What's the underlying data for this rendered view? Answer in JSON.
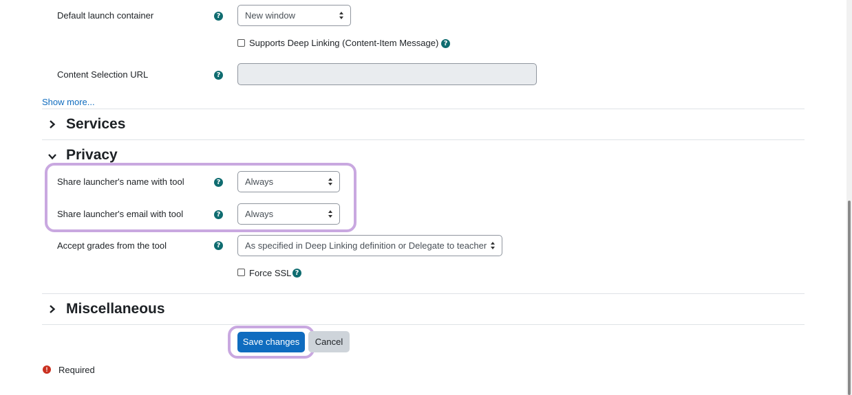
{
  "fields": {
    "launch_container": {
      "label": "Default launch container",
      "value": "New window"
    },
    "deep_linking": {
      "label": "Supports Deep Linking (Content-Item Message)"
    },
    "content_selection": {
      "label": "Content Selection URL",
      "value": ""
    },
    "show_more": "Show more..."
  },
  "sections": {
    "services": "Services",
    "privacy": "Privacy",
    "misc": "Miscellaneous"
  },
  "privacy": {
    "share_name": {
      "label": "Share launcher's name with tool",
      "value": "Always"
    },
    "share_email": {
      "label": "Share launcher's email with tool",
      "value": "Always"
    },
    "accept_grades": {
      "label": "Accept grades from the tool",
      "value": "As specified in Deep Linking definition or Delegate to teacher"
    },
    "force_ssl": {
      "label": "Force SSL"
    }
  },
  "actions": {
    "save": "Save changes",
    "cancel": "Cancel"
  },
  "required": {
    "icon": "!",
    "label": "Required"
  },
  "icons": {
    "help": "?"
  },
  "colors": {
    "primary": "#0f6cbf",
    "help": "#0f6c70",
    "highlight": "#c9a8e0",
    "required": "#ca3120"
  }
}
